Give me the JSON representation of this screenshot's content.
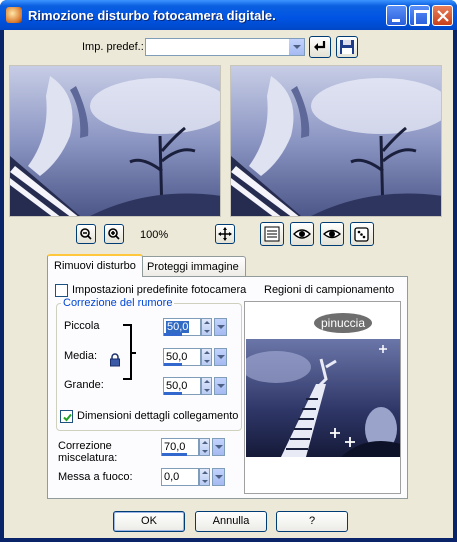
{
  "window": {
    "title": "Rimozione disturbo fotocamera digitale."
  },
  "preset": {
    "label": "Imp. predef.:",
    "value": ""
  },
  "zoom": {
    "level": "100%"
  },
  "tabs": [
    {
      "label": "Rimuovi disturbo",
      "active": true
    },
    {
      "label": "Proteggi immagine",
      "active": false
    }
  ],
  "noise_tab": {
    "camera_presets_label": "Impostazioni predefinite fotocamera",
    "camera_presets_checked": false,
    "group_title": "Correzione del rumore",
    "small_label": "Piccola",
    "small_value": "50,0",
    "medium_label": "Media:",
    "medium_value": "50,0",
    "large_label": "Grande:",
    "large_value": "50,0",
    "link_label": "Dimensioni dettagli collegamento",
    "link_checked": true,
    "blend_label_line1": "Correzione",
    "blend_label_line2": "miscelatura:",
    "blend_value": "70,0",
    "sharpen_label": "Messa a fuoco:",
    "sharpen_value": "0,0",
    "regions_label": "Regioni di campionamento",
    "watermark_text": "pinuccia"
  },
  "buttons": {
    "ok": "OK",
    "cancel": "Annulla",
    "help": "?"
  },
  "levels": {
    "small": 0.5,
    "medium": 0.5,
    "large": 0.5,
    "blend": 0.7,
    "sharpen": 0.0
  },
  "colors": {
    "titlebar": "#0054e3",
    "accent_selection": "#316ac5",
    "tab_highlight": "#ffc83c"
  }
}
